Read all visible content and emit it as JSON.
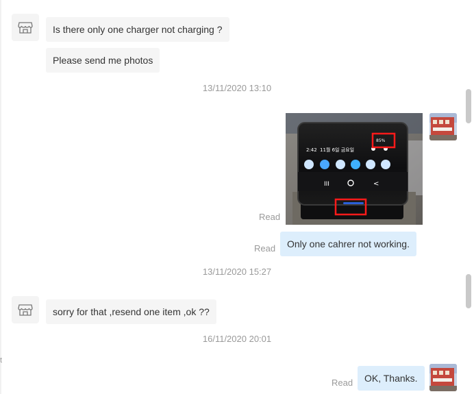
{
  "messages": {
    "m1": "Is there only one charger not charging ?",
    "m2": "Please send me photos",
    "m3": "Only one cahrer not working.",
    "m4": "sorry for that ,resend one item ,ok ??",
    "m5": "OK, Thanks."
  },
  "timestamps": {
    "t1": "13/11/2020 13:10",
    "t2": "13/11/2020 15:27",
    "t3": "16/11/2020 20:01"
  },
  "status": {
    "read_photo": "Read",
    "read_m3": "Read",
    "read_m5": "Read"
  },
  "photo": {
    "status_bar_text": "85%",
    "date_text": "11월 6일 금요일",
    "clock_text": "2:42",
    "highlight_color": "#ff1a1a"
  },
  "edge": {
    "cut_char": "t"
  }
}
